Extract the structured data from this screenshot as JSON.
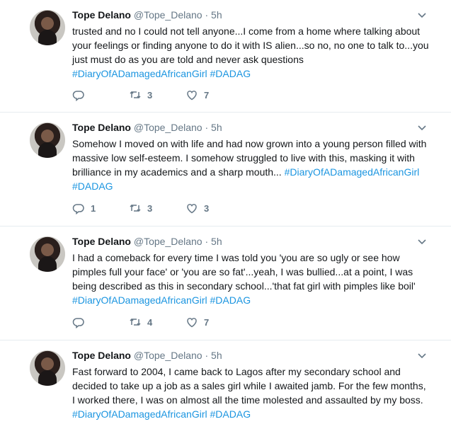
{
  "tweets": [
    {
      "name": "Tope Delano",
      "handle": "@Tope_Delano",
      "dot": "·",
      "time": "5h",
      "text": "trusted and no I could not tell anyone...I come from a home where talking about your feelings or finding anyone to do it with IS alien...so no, no one to talk to...you just must do as you are told and never ask questions ",
      "tags": " #DiaryOfADamagedAfricanGirl #DADAG",
      "replies": "",
      "retweets": "3",
      "likes": "7"
    },
    {
      "name": "Tope Delano",
      "handle": "@Tope_Delano",
      "dot": "·",
      "time": "5h",
      "text": "Somehow I moved on with life and had now grown into a young person filled with massive low self-esteem. I somehow struggled to live with this, masking it with brilliance in my academics and a sharp mouth... ",
      "tags": "#DiaryOfADamagedAfricanGirl #DADAG",
      "replies": "1",
      "retweets": "3",
      "likes": "3"
    },
    {
      "name": "Tope Delano",
      "handle": "@Tope_Delano",
      "dot": "·",
      "time": "5h",
      "text": "I had a comeback for every time I was told you 'you are so ugly or see how pimples full your face' or 'you are so fat'...yeah, I was bullied...at a point, I was being described as this in secondary school...'that fat girl with pimples like boil' ",
      "tags": "#DiaryOfADamagedAfricanGirl #DADAG",
      "replies": "",
      "retweets": "4",
      "likes": "7"
    },
    {
      "name": "Tope Delano",
      "handle": "@Tope_Delano",
      "dot": "·",
      "time": "5h",
      "text": "Fast forward to 2004, I came back to Lagos after my secondary school and decided to take up a job as a sales girl while I awaited jamb. For the few months, I worked there, I was on almost all the time molested and assaulted by my boss. ",
      "tags": " #DiaryOfADamagedAfricanGirl #DADAG",
      "replies": "",
      "retweets": "",
      "likes": ""
    }
  ],
  "colors": {
    "accent": "#1b95e0",
    "muted": "#657786",
    "text": "#14171a"
  },
  "icons": [
    "chevron-down-icon",
    "reply-icon",
    "retweet-icon",
    "like-icon"
  ]
}
